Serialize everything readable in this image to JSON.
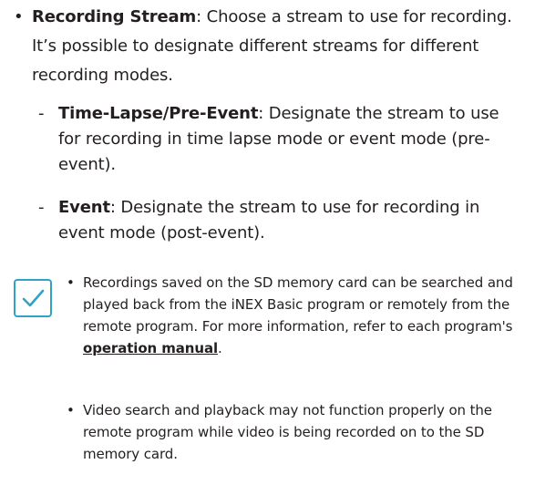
{
  "main": {
    "bullet": "•",
    "term": "Recording Stream",
    "description": ": Choose a stream to use for recording. It’s possible to designate different streams for different recording modes."
  },
  "sub_items": [
    {
      "dash": "-",
      "term": "Time-Lapse/Pre-Event",
      "description": ": Designate the stream to use for recording in time lapse mode or event mode (pre-event)."
    },
    {
      "dash": "-",
      "term": "Event",
      "description": ": Designate the stream to use for recording in event mode (post-event)."
    }
  ],
  "note": {
    "icon": "checkmark-icon",
    "icon_color": "#2fa3c6",
    "items": [
      {
        "bullet": "•",
        "text_before": "Recordings saved on the SD memory card can be searched and played back from the iNEX Basic program or remotely from the remote program. For more information, refer to each program's ",
        "link": "operation manual",
        "text_after": "."
      },
      {
        "bullet": "•",
        "text": "Video search and playback may not function properly on the remote program while video is being recorded on to the SD memory card."
      }
    ]
  }
}
